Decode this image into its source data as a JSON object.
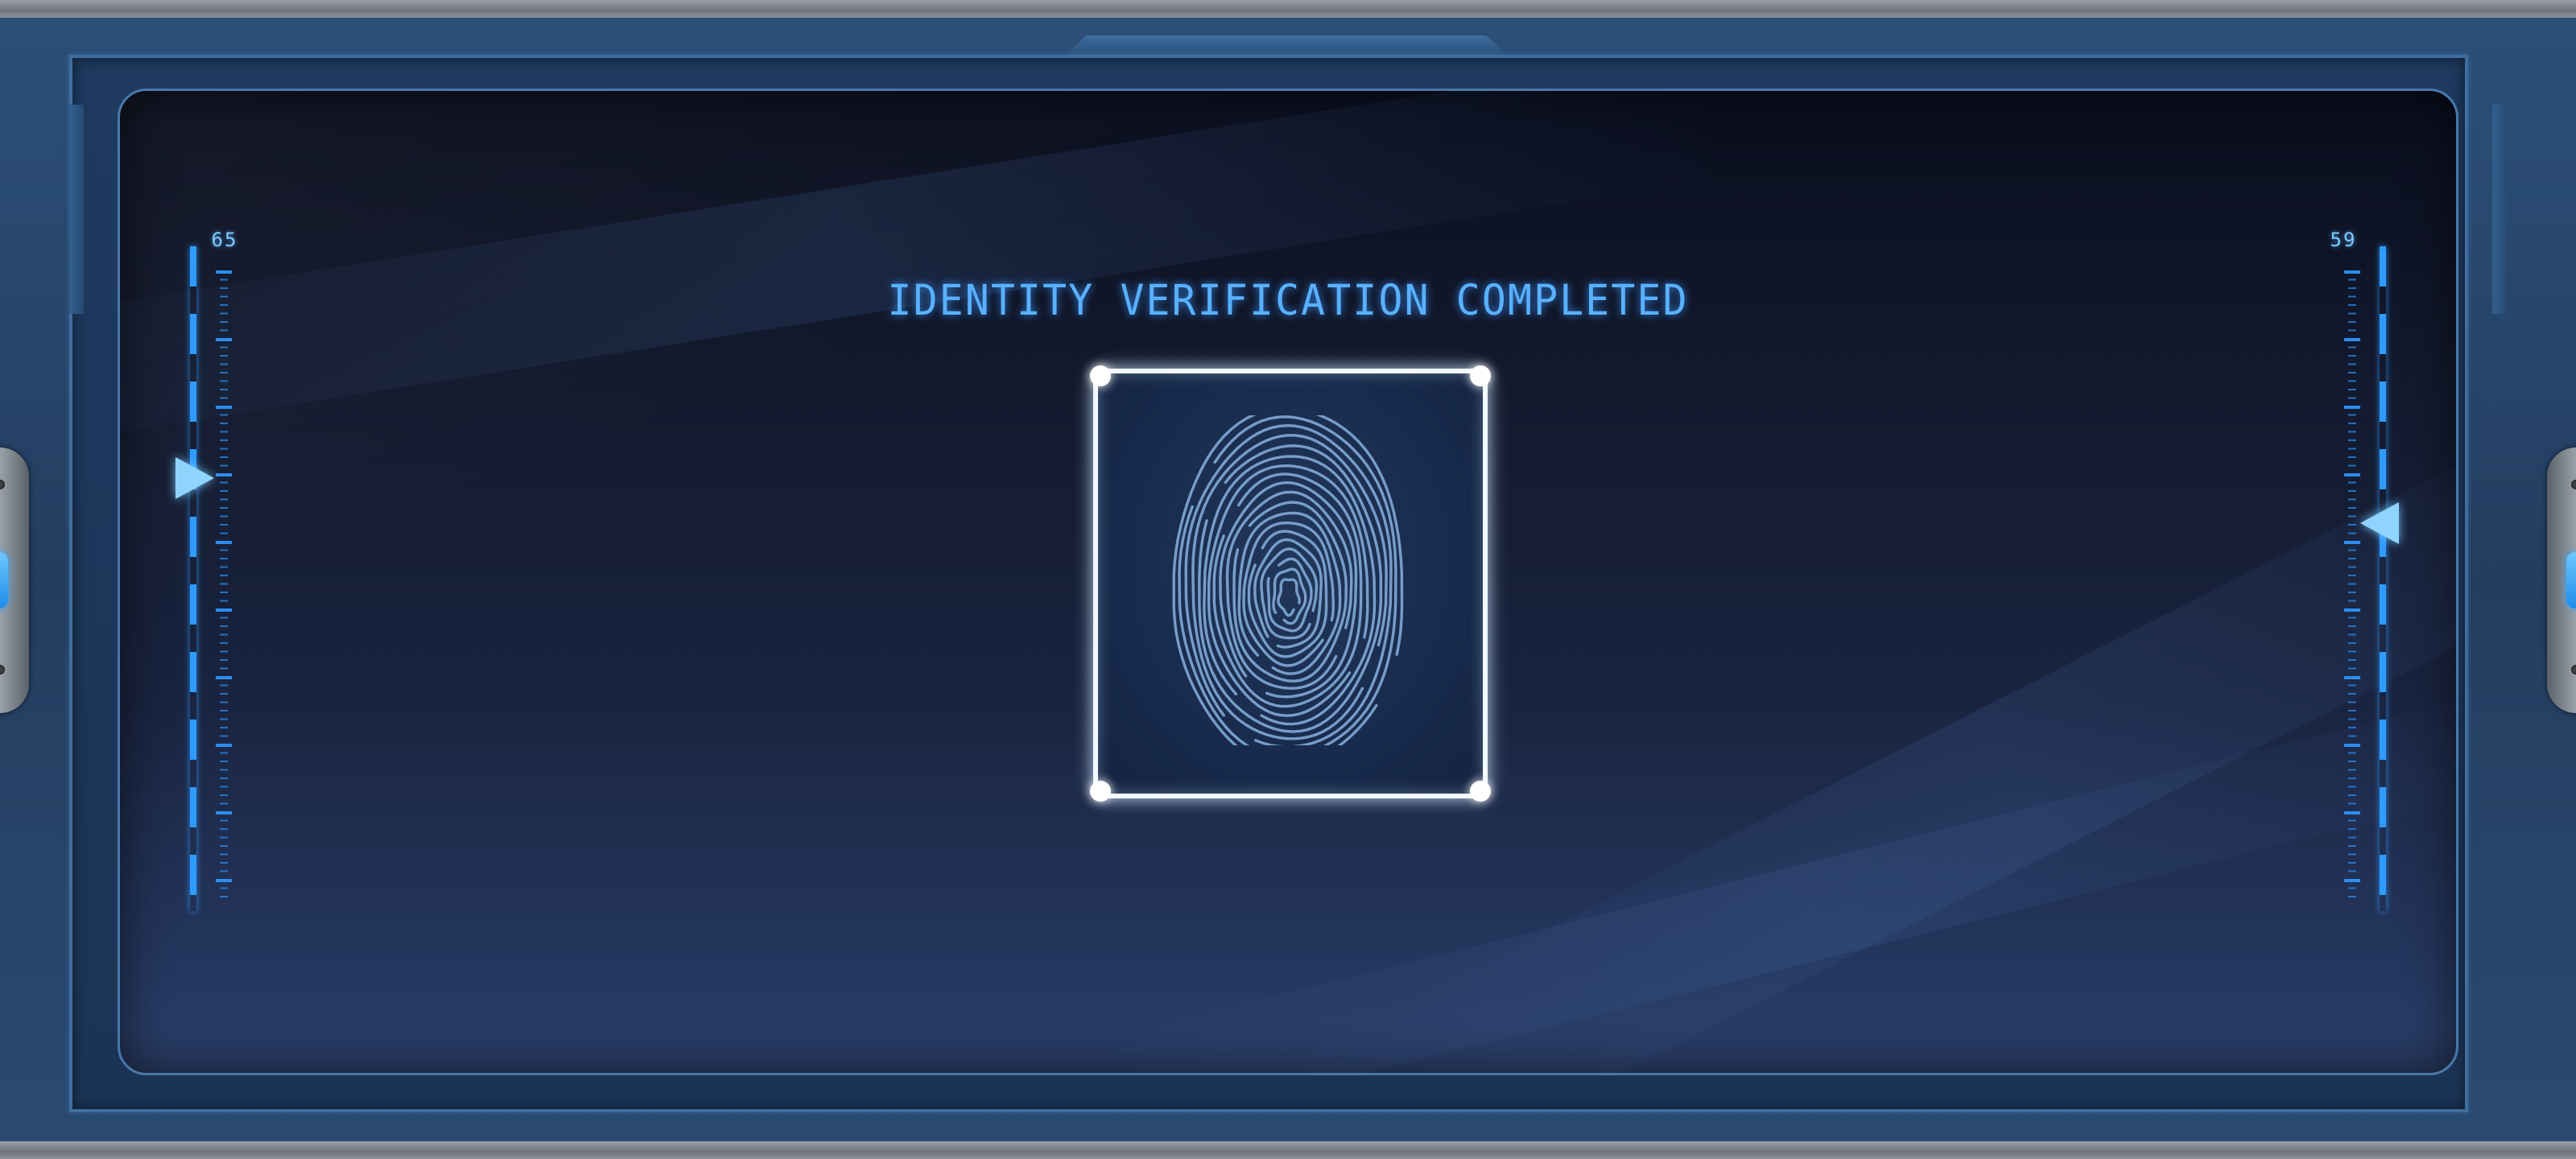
{
  "screen": {
    "title": "IDENTITY VERIFICATION COMPLETED"
  },
  "left_gauge": {
    "value": "65"
  },
  "right_gauge": {
    "value": "59"
  },
  "scanner": {
    "icon": "fingerprint-icon",
    "status": "completed"
  },
  "colors": {
    "accent": "#2f9bff",
    "title": "#59b0ff",
    "scanner_frame": "#f2f8ff",
    "fingerprint": "#7fa7d4"
  }
}
